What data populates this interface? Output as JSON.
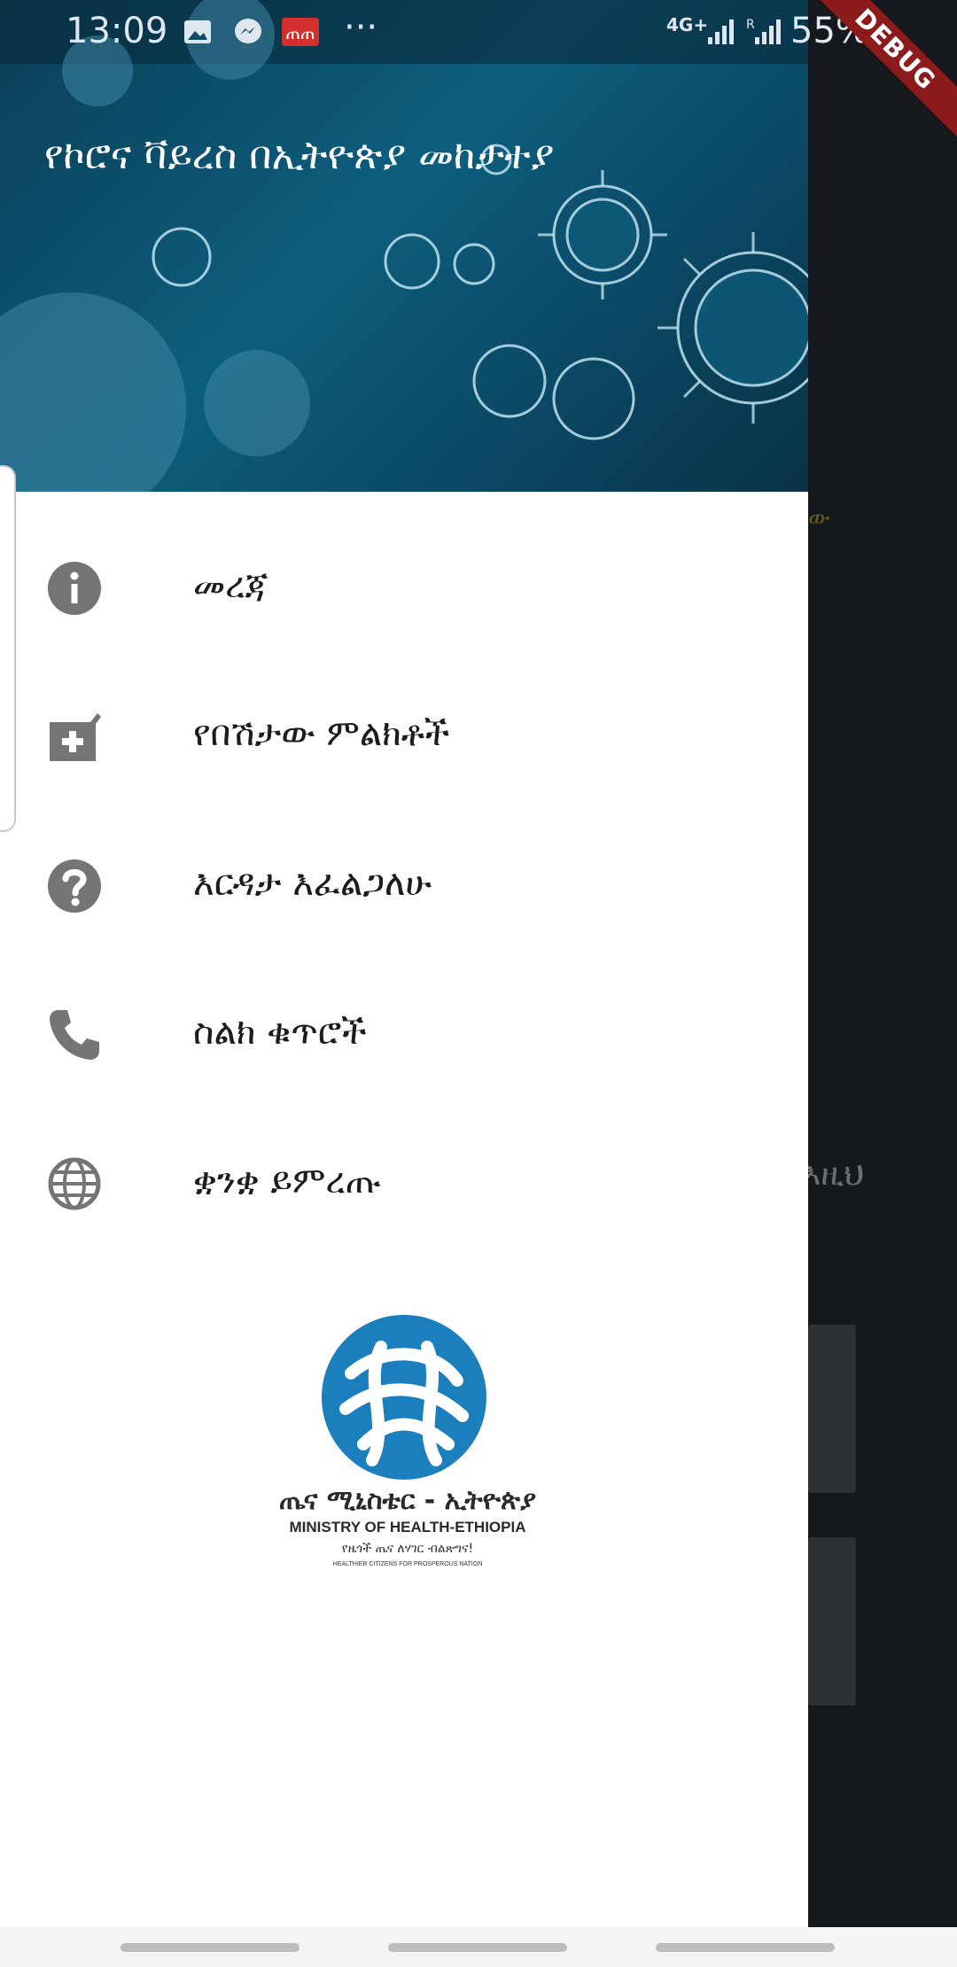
{
  "status_bar": {
    "time": "13:09",
    "network": "4G+",
    "battery": "55%"
  },
  "debug_label": "DEBUG",
  "drawer": {
    "title": "የኮሮና ቫይረስ በኢትዮጵያ መከታተያ",
    "items": [
      {
        "label": "መረጃ",
        "icon": "info-icon"
      },
      {
        "label": "የበሽታው ምልክቶች",
        "icon": "medical-kit-icon"
      },
      {
        "label": "እርዳታ እፈልጋለሁ",
        "icon": "help-icon"
      },
      {
        "label": "ስልክ ቁጥሮች",
        "icon": "phone-icon"
      },
      {
        "label": "ቋንቋ ይምረጡ",
        "icon": "globe-icon"
      }
    ],
    "logo": {
      "name_am": "ጤና ሚኒስቴር - ኢትዮጵያ",
      "name_en": "MINISTRY OF HEALTH-ETHIOPIA",
      "tagline_am": "የዜጎች ጤና ለሃገር ብልጽግና!",
      "tagline_en": "HEALTHIER CITIZENS FOR PROSPEROUS NATION"
    }
  },
  "background": {
    "accent_text": "ው",
    "side_text": "እዚህ"
  },
  "colors": {
    "header": "#0b4a66",
    "icon_gray": "#757575",
    "logo_blue": "#1b7fbe",
    "debug": "#8e1b1b"
  }
}
